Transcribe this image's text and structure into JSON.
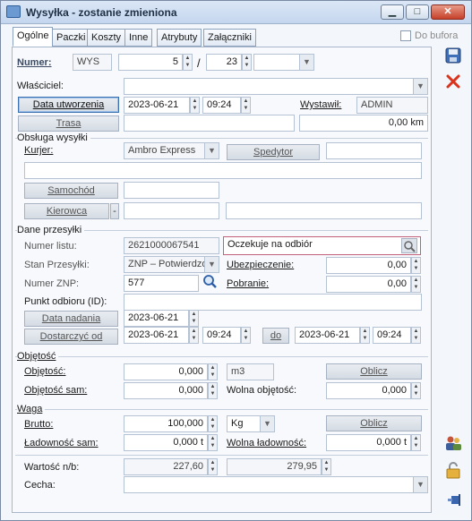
{
  "window": {
    "title": "Wysyłka - zostanie zmieniona",
    "min_label": "▁",
    "max_label": "□",
    "close_label": "✕"
  },
  "tabs": [
    "Ogólne",
    "Paczki",
    "Koszty",
    "Inne",
    "Atrybuty",
    "Załączniki"
  ],
  "do_bufora": {
    "label": "Do bufora",
    "checked": false
  },
  "header": {
    "numer_label": "Numer:",
    "numer_prefix": "WYS",
    "numer_num": "5",
    "numer_sep1": "/",
    "numer_year": "23",
    "numer_sep2": "/",
    "numer_series": "",
    "wlasciciel_label": "Właściciel:",
    "wlasciciel_value": "",
    "data_utworzenia_btn": "Data utworzenia",
    "data_utworzenia": "2023-06-21",
    "time_utworzenia": "09:24",
    "wystawil_label": "Wystawił:",
    "wystawil_value": "ADMIN",
    "trasa_btn": "Trasa",
    "trasa_value": "",
    "km_value": "0,00 km"
  },
  "obsluga": {
    "title": "Obsługa wysyłki",
    "kurier_label": "Kurjer:",
    "kurier_value": "Ambro Express",
    "spedytor_btn": "Spedytor",
    "spedytor_value": "",
    "address_value": "",
    "samochod_btn": "Samochód",
    "samochod_value": "",
    "kierowca_btn": "Kierowca",
    "kierowca_dash": "-",
    "kierowca_value1": "",
    "kierowca_value2": ""
  },
  "dane": {
    "title": "Dane przesyłki",
    "numer_listu_label": "Numer listu:",
    "numer_listu": "2621000067541",
    "status_value": "Oczekuje na odbiór",
    "stan_label": "Stan Przesyłki:",
    "stan_value": "ZNP – Potwierdzo",
    "ubezpieczenie_label": "Ubezpieczenie:",
    "ubezpieczenie_value": "0,00",
    "numer_znp_label": "Numer ZNP:",
    "numer_znp": "577",
    "pobranie_label": "Pobranie:",
    "pobranie_value": "0,00",
    "punkt_label": "Punkt odbioru (ID):",
    "punkt_value": "",
    "data_nadania_btn": "Data nadania",
    "data_nadania": "2023-06-21",
    "dostarczyc_btn": "Dostarczyć od",
    "od_date": "2023-06-21",
    "od_time": "09:24",
    "do_btn": "do",
    "do_date": "2023-06-21",
    "do_time": "09:24"
  },
  "objetosc": {
    "title": "Objętość",
    "objetosc_label": "Objętość:",
    "objetosc_value": "0,000",
    "unit": "m3",
    "oblicz_btn": "Oblicz",
    "objetosc_sam_label": "Objętość sam:",
    "objetosc_sam_value": "0,000",
    "wolna_label": "Wolna objętość:",
    "wolna_value": "0,000"
  },
  "waga": {
    "title": "Waga",
    "brutto_label": "Brutto:",
    "brutto_value": "100,000",
    "unit": "Kg",
    "oblicz_btn": "Oblicz",
    "ladownosc_sam_label": "Ładowność sam:",
    "ladownosc_sam_value": "0,000 t",
    "wolna_label": "Wolna ładowność:",
    "wolna_value": "0,000 t"
  },
  "footer": {
    "wartosc_label": "Wartość n/b:",
    "wartosc1": "227,60",
    "wartosc2": "279,95",
    "cecha_label": "Cecha:",
    "cecha_value": ""
  },
  "icons": {
    "save": "save-icon",
    "delete": "delete-icon",
    "users": "users-icon",
    "lock": "lock-icon",
    "pin": "pin-icon"
  },
  "colors": {
    "accent_border": "#3a6fb0",
    "status_border": "#c0607a",
    "delete_red": "#d9331e"
  }
}
